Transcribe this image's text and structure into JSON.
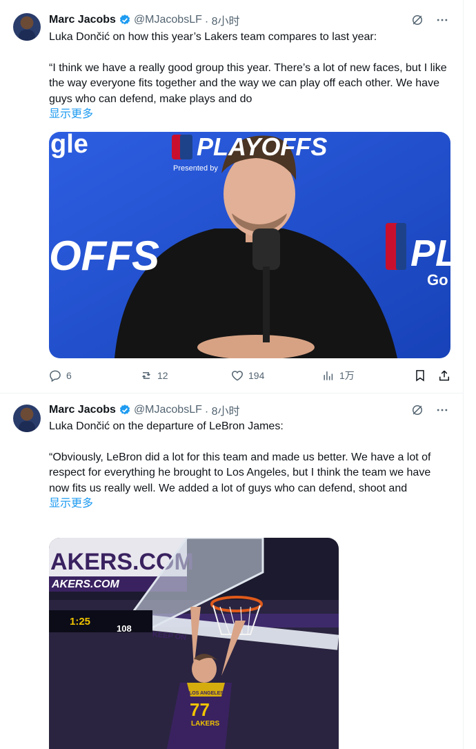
{
  "tweets": [
    {
      "author_name": "Marc Jacobs",
      "handle": "@MJacobsLF",
      "time": "· 8小时",
      "line1": "Luka Dončić on how this year’s Lakers team compares to last year:",
      "quote": "“I think we have a really good group this year. There’s a lot of new faces, but I like the way everyone fits together and the way we can play off each other. We have guys who can defend, make plays and do",
      "show_more": "显示更多",
      "replies": "6",
      "reposts": "12",
      "likes": "194",
      "views": "1万",
      "image_text_left": "gle",
      "image_text_top": "PLAYOFFS",
      "image_text_mid": "OFFS",
      "image_text_presented": "Presented by",
      "image_text_right": "PL",
      "image_text_go": "Go"
    },
    {
      "author_name": "Marc Jacobs",
      "handle": "@MJacobsLF",
      "time": "· 8小时",
      "line1": "Luka Dončić on the departure of LeBron James:",
      "quote": "“Obviously, LeBron did a lot for this team and made us better. We have a lot of respect for everything he brought to Los Angeles, but I think the team we have now fits us really well. We added a lot of guys who can defend, shoot and",
      "show_more": "显示更多",
      "image_text_banner": "AKERS.COM",
      "image_text_banner2": "AKERS.COM",
      "image_text_clock": "1:25",
      "image_text_score": "108",
      "image_text_jersey_num": "77",
      "image_text_jersey_team": "LAKERS",
      "image_text_jersey_top": "LOS ANGELES",
      "image_text_keep": "KEEP ON"
    }
  ],
  "colors": {
    "link": "#1d9bf0",
    "secondary": "#536471",
    "verified": "#1d9bf0",
    "playoff_blue": "#1e4fd1",
    "lakers_purple": "#3a2260"
  },
  "icons": [
    "verified-badge-icon",
    "grok-icon",
    "more-icon",
    "reply-icon",
    "repost-icon",
    "like-icon",
    "views-icon",
    "bookmark-icon",
    "share-icon"
  ]
}
